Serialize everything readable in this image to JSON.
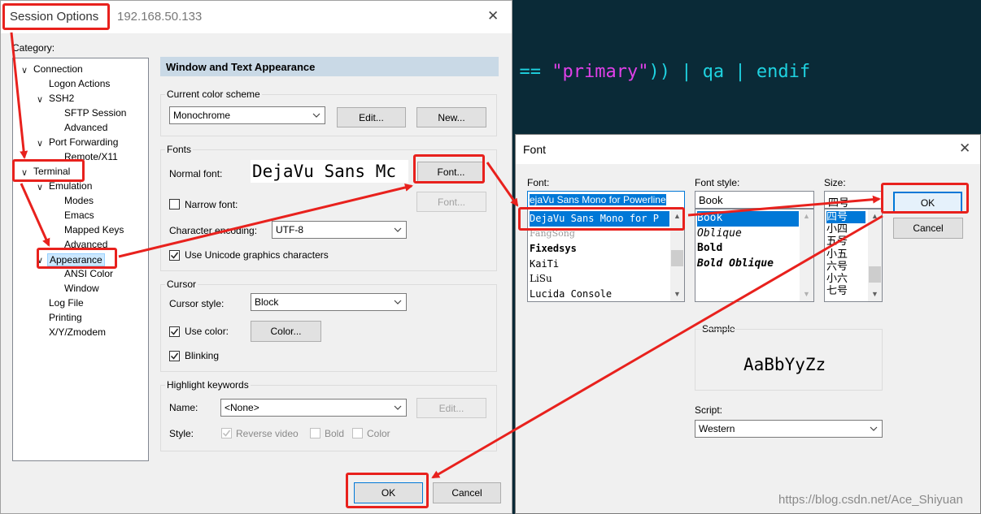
{
  "terminal": {
    "code_parts": [
      {
        "text": "e == ",
        "color": "#1fd2e0"
      },
      {
        "text": "\"primary\"",
        "color": "#e040e8"
      },
      {
        "text": ")) | qa | endif",
        "color": "#1fd2e0"
      }
    ]
  },
  "session_dialog": {
    "title": "Session Options",
    "host": "192.168.50.133",
    "close_glyph": "✕",
    "category_label": "Category:",
    "tree": [
      {
        "label": "Connection",
        "level": 0,
        "expanded": true
      },
      {
        "label": "Logon Actions",
        "level": 1
      },
      {
        "label": "SSH2",
        "level": 1,
        "expanded": true
      },
      {
        "label": "SFTP Session",
        "level": 2
      },
      {
        "label": "Advanced",
        "level": 2
      },
      {
        "label": "Port Forwarding",
        "level": 1,
        "expanded": true
      },
      {
        "label": "Remote/X11",
        "level": 2
      },
      {
        "label": "Terminal",
        "level": 0,
        "expanded": true
      },
      {
        "label": "Emulation",
        "level": 1,
        "expanded": true
      },
      {
        "label": "Modes",
        "level": 2
      },
      {
        "label": "Emacs",
        "level": 2
      },
      {
        "label": "Mapped Keys",
        "level": 2
      },
      {
        "label": "Advanced",
        "level": 2
      },
      {
        "label": "Appearance",
        "level": 1,
        "expanded": true,
        "selected": true
      },
      {
        "label": "ANSI Color",
        "level": 2
      },
      {
        "label": "Window",
        "level": 2
      },
      {
        "label": "Log File",
        "level": 1
      },
      {
        "label": "Printing",
        "level": 1
      },
      {
        "label": "X/Y/Zmodem",
        "level": 1
      }
    ],
    "section_header": "Window and Text Appearance",
    "color_scheme": {
      "label": "Current color scheme",
      "value": "Monochrome",
      "edit_button": "Edit...",
      "new_button": "New..."
    },
    "fonts": {
      "label": "Fonts",
      "normal_font_label": "Normal font:",
      "normal_font_preview": "DejaVu Sans Mc",
      "font_button": "Font...",
      "narrow_font_label": "Narrow font:",
      "narrow_font_button": "Font...",
      "encoding_label": "Character encoding:",
      "encoding_value": "UTF-8",
      "unicode_label": "Use Unicode graphics characters",
      "unicode_checked": true
    },
    "cursor": {
      "label": "Cursor",
      "style_label": "Cursor style:",
      "style_value": "Block",
      "use_color_label": "Use color:",
      "use_color_checked": true,
      "color_button": "Color...",
      "blinking_label": "Blinking",
      "blinking_checked": true
    },
    "highlight": {
      "label": "Highlight keywords",
      "name_label": "Name:",
      "name_value": "<None>",
      "edit_button": "Edit...",
      "style_label": "Style:",
      "reverse_video": "Reverse video",
      "bold": "Bold",
      "color": "Color"
    },
    "ok_button": "OK",
    "cancel_button": "Cancel"
  },
  "font_dialog": {
    "title": "Font",
    "close_glyph": "✕",
    "font_label": "Font:",
    "font_input": "ejaVu Sans Mono for Powerline",
    "fonts": [
      {
        "name": "DejaVu Sans Mono for P",
        "selected": true
      },
      {
        "name": "FangSong"
      },
      {
        "name": "Fixedsys"
      },
      {
        "name": "KaiTi"
      },
      {
        "name": "LiSu"
      },
      {
        "name": "Lucida Console"
      }
    ],
    "style_label": "Font style:",
    "style_input": "Book",
    "styles": [
      "Book",
      "Oblique",
      "Bold",
      "Bold Oblique"
    ],
    "size_label": "Size:",
    "size_input": "四号",
    "sizes": [
      "四号",
      "小四",
      "五号",
      "小五",
      "六号",
      "小六",
      "七号"
    ],
    "ok_button": "OK",
    "cancel_button": "Cancel",
    "sample_label": "Sample",
    "sample_text": "AaBbYyZz",
    "script_label": "Script:",
    "script_value": "Western"
  },
  "watermark": "https://blog.csdn.net/Ace_Shiyuan",
  "colors": {
    "annotation_red": "#e8211d",
    "terminal_bg": "#0a2a37",
    "selection_blue": "#0078d7"
  }
}
